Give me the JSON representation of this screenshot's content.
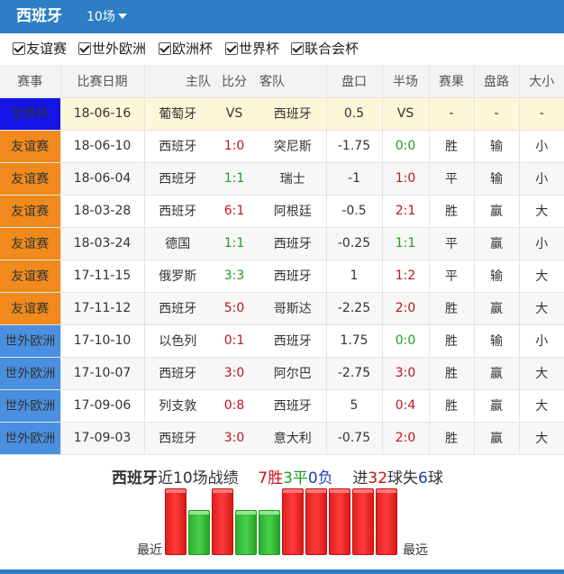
{
  "header": {
    "team": "西班牙",
    "count_label": "10场"
  },
  "colors": {
    "header_bg": "#2d7ec4",
    "friendly": "#f08a1c",
    "world_cup": "#1414e6",
    "wc_qual_europe": "#4a8fe0",
    "win": "#e02020",
    "draw": "#33b533"
  },
  "filters": [
    {
      "label": "友谊赛",
      "checked": true
    },
    {
      "label": "世外欧洲",
      "checked": true
    },
    {
      "label": "欧洲杯",
      "checked": true
    },
    {
      "label": "世界杯",
      "checked": true
    },
    {
      "label": "联合会杯",
      "checked": true
    }
  ],
  "columns": [
    "赛事",
    "比赛日期",
    "主队",
    "比分",
    "客队",
    "盘口",
    "半场",
    "赛果",
    "盘路",
    "大小"
  ],
  "matches": [
    {
      "comp": "世界杯",
      "comp_type": "world_cup",
      "date": "18-06-16",
      "home": "葡萄牙",
      "score": "VS",
      "away": "西班牙",
      "handicap": "0.5",
      "half": "VS",
      "result": "-",
      "ah": "-",
      "ou": "-"
    },
    {
      "comp": "友谊赛",
      "comp_type": "friendly",
      "date": "18-06-10",
      "home": "西班牙",
      "score": "1:0",
      "away": "突尼斯",
      "handicap": "-1.75",
      "half": "0:0",
      "result": "胜",
      "ah": "输",
      "ou": "小"
    },
    {
      "comp": "友谊赛",
      "comp_type": "friendly",
      "date": "18-06-04",
      "home": "西班牙",
      "score": "1:1",
      "away": "瑞士",
      "handicap": "-1",
      "half": "1:0",
      "result": "平",
      "ah": "输",
      "ou": "小"
    },
    {
      "comp": "友谊赛",
      "comp_type": "friendly",
      "date": "18-03-28",
      "home": "西班牙",
      "score": "6:1",
      "away": "阿根廷",
      "handicap": "-0.5",
      "half": "2:1",
      "result": "胜",
      "ah": "赢",
      "ou": "大"
    },
    {
      "comp": "友谊赛",
      "comp_type": "friendly",
      "date": "18-03-24",
      "home": "德国",
      "score": "1:1",
      "away": "西班牙",
      "handicap": "-0.25",
      "half": "1:1",
      "result": "平",
      "ah": "赢",
      "ou": "小"
    },
    {
      "comp": "友谊赛",
      "comp_type": "friendly",
      "date": "17-11-15",
      "home": "俄罗斯",
      "score": "3:3",
      "away": "西班牙",
      "handicap": "1",
      "half": "1:2",
      "result": "平",
      "ah": "输",
      "ou": "大"
    },
    {
      "comp": "友谊赛",
      "comp_type": "friendly",
      "date": "17-11-12",
      "home": "西班牙",
      "score": "5:0",
      "away": "哥斯达",
      "handicap": "-2.25",
      "half": "2:0",
      "result": "胜",
      "ah": "赢",
      "ou": "大"
    },
    {
      "comp": "世外欧洲",
      "comp_type": "wc_qual_europe",
      "date": "17-10-10",
      "home": "以色列",
      "score": "0:1",
      "away": "西班牙",
      "handicap": "1.75",
      "half": "0:0",
      "result": "胜",
      "ah": "输",
      "ou": "小"
    },
    {
      "comp": "世外欧洲",
      "comp_type": "wc_qual_europe",
      "date": "17-10-07",
      "home": "西班牙",
      "score": "3:0",
      "away": "阿尔巴",
      "handicap": "-2.75",
      "half": "3:0",
      "result": "胜",
      "ah": "赢",
      "ou": "大"
    },
    {
      "comp": "世外欧洲",
      "comp_type": "wc_qual_europe",
      "date": "17-09-06",
      "home": "列支敦",
      "score": "0:8",
      "away": "西班牙",
      "handicap": "5",
      "half": "0:4",
      "result": "胜",
      "ah": "赢",
      "ou": "大"
    },
    {
      "comp": "世外欧洲",
      "comp_type": "wc_qual_europe",
      "date": "17-09-03",
      "home": "西班牙",
      "score": "3:0",
      "away": "意大利",
      "handicap": "-0.75",
      "half": "2:0",
      "result": "胜",
      "ah": "赢",
      "ou": "大"
    }
  ],
  "summary": {
    "team": "西班牙",
    "text_recent": "近10场战绩",
    "wins": "7",
    "win_unit": "胜",
    "draws": "3",
    "draw_unit": "平",
    "losses": "0",
    "loss_unit": "负",
    "goals_pre": "进",
    "goals_for": "32",
    "goals_mid": "球失",
    "goals_against": "6",
    "goals_post": "球"
  },
  "form_chart": {
    "label_left": "最近",
    "label_right": "最远",
    "results": [
      "胜",
      "平",
      "胜",
      "平",
      "平",
      "胜",
      "胜",
      "胜",
      "胜",
      "胜"
    ]
  }
}
